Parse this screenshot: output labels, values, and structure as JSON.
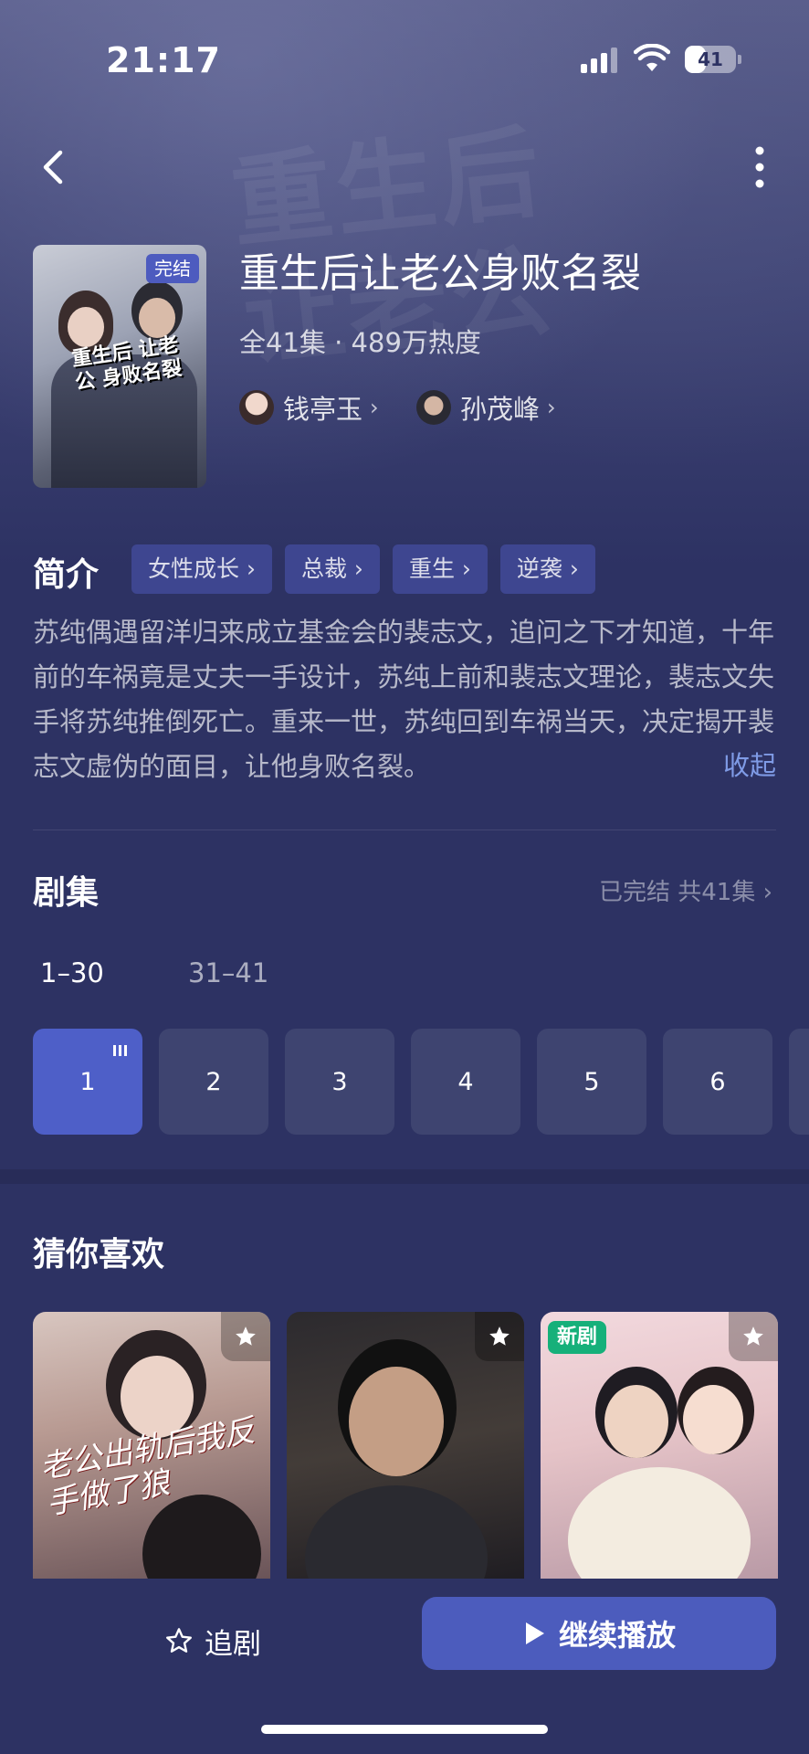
{
  "status_bar": {
    "time": "21:17",
    "battery": "41",
    "battery_level": 0.41
  },
  "drama": {
    "poster_badge": "完结",
    "poster_title": "重生后 让老公 身败名裂",
    "title": "重生后让老公身败名裂",
    "meta": "全41集 · 489万热度",
    "actors": [
      {
        "name": "钱亭玉"
      },
      {
        "name": "孙茂峰"
      }
    ]
  },
  "synopsis": {
    "heading": "简介",
    "tags": [
      "女性成长",
      "总裁",
      "重生",
      "逆袭"
    ],
    "text": "苏纯偶遇留洋归来成立基金会的裴志文，追问之下才知道，十年前的车祸竟是丈夫一手设计，苏纯上前和裴志文理论，裴志文失手将苏纯推倒死亡。重来一世，苏纯回到车祸当天，决定揭开裴志文虚伪的面目，让他身败名裂。",
    "collapse_label": "收起"
  },
  "episodes": {
    "heading": "剧集",
    "status": "已完结 共41集",
    "ranges": [
      "1–30",
      "31–41"
    ],
    "items": [
      "1",
      "2",
      "3",
      "4",
      "5",
      "6"
    ],
    "active": "1"
  },
  "recommend": {
    "heading": "猜你喜欢",
    "items": [
      {
        "caption": "老公出轨后我反手做了狼",
        "badge": ""
      },
      {
        "caption": "",
        "badge": ""
      },
      {
        "caption": "",
        "badge": "新剧"
      }
    ]
  },
  "bottom_bar": {
    "follow_label": "追剧",
    "play_label": "继续播放"
  },
  "colors": {
    "background": "#2d3263",
    "accent": "#4c5cbd",
    "tag_bg": "#3e4690",
    "link": "#7f9be6",
    "new_badge": "#16b07a"
  },
  "icons": [
    "back-icon",
    "more-icon",
    "chevron-right-icon",
    "star-icon",
    "play-icon",
    "playing-icon"
  ]
}
